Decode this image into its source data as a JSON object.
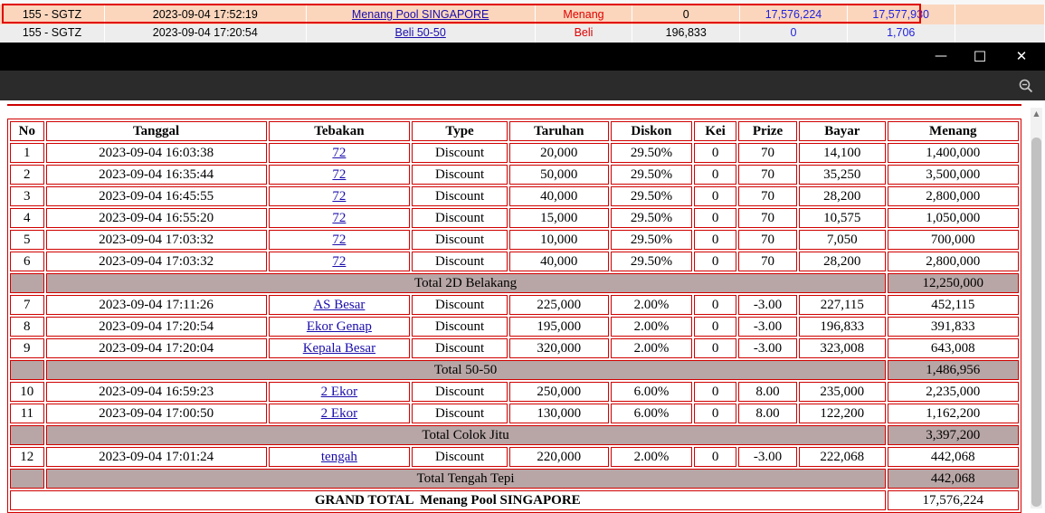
{
  "listing": {
    "row1": {
      "code": "155 - SGTZ",
      "datetime": "2023-09-04 17:52:19",
      "description": "Menang Pool SINGAPORE",
      "type": "Menang",
      "debit": "0",
      "credit": "17,576,224",
      "balance": "17,577,930"
    },
    "row2": {
      "code": "155 - SGTZ",
      "datetime": "2023-09-04 17:20:54",
      "description": "Beli 50-50",
      "type": "Beli",
      "debit": "196,833",
      "credit": "0",
      "balance": "1,706"
    }
  },
  "window": {
    "minimize": "—",
    "maximize": "☐",
    "close": "✕"
  },
  "table": {
    "headers": [
      "No",
      "Tanggal",
      "Tebakan",
      "Type",
      "Taruhan",
      "Diskon",
      "Kei",
      "Prize",
      "Bayar",
      "Menang"
    ],
    "groups": [
      {
        "rows": [
          [
            "1",
            "2023-09-04 16:03:38",
            "72",
            "Discount",
            "20,000",
            "29.50%",
            "0",
            "70",
            "14,100",
            "1,400,000"
          ],
          [
            "2",
            "2023-09-04 16:35:44",
            "72",
            "Discount",
            "50,000",
            "29.50%",
            "0",
            "70",
            "35,250",
            "3,500,000"
          ],
          [
            "3",
            "2023-09-04 16:45:55",
            "72",
            "Discount",
            "40,000",
            "29.50%",
            "0",
            "70",
            "28,200",
            "2,800,000"
          ],
          [
            "4",
            "2023-09-04 16:55:20",
            "72",
            "Discount",
            "15,000",
            "29.50%",
            "0",
            "70",
            "10,575",
            "1,050,000"
          ],
          [
            "5",
            "2023-09-04 17:03:32",
            "72",
            "Discount",
            "10,000",
            "29.50%",
            "0",
            "70",
            "7,050",
            "700,000"
          ],
          [
            "6",
            "2023-09-04 17:03:32",
            "72",
            "Discount",
            "40,000",
            "29.50%",
            "0",
            "70",
            "28,200",
            "2,800,000"
          ]
        ],
        "total_label": "Total 2D Belakang",
        "total_value": "12,250,000"
      },
      {
        "rows": [
          [
            "7",
            "2023-09-04 17:11:26",
            "AS Besar",
            "Discount",
            "225,000",
            "2.00%",
            "0",
            "-3.00",
            "227,115",
            "452,115"
          ],
          [
            "8",
            "2023-09-04 17:20:54",
            "Ekor Genap",
            "Discount",
            "195,000",
            "2.00%",
            "0",
            "-3.00",
            "196,833",
            "391,833"
          ],
          [
            "9",
            "2023-09-04 17:20:04",
            "Kepala Besar",
            "Discount",
            "320,000",
            "2.00%",
            "0",
            "-3.00",
            "323,008",
            "643,008"
          ]
        ],
        "total_label": "Total 50-50",
        "total_value": "1,486,956"
      },
      {
        "rows": [
          [
            "10",
            "2023-09-04 16:59:23",
            "2 Ekor",
            "Discount",
            "250,000",
            "6.00%",
            "0",
            "8.00",
            "235,000",
            "2,235,000"
          ],
          [
            "11",
            "2023-09-04 17:00:50",
            "2 Ekor",
            "Discount",
            "130,000",
            "6.00%",
            "0",
            "8.00",
            "122,200",
            "1,162,200"
          ]
        ],
        "total_label": "Total Colok Jitu",
        "total_value": "3,397,200"
      },
      {
        "rows": [
          [
            "12",
            "2023-09-04 17:01:24",
            "tengah",
            "Discount",
            "220,000",
            "2.00%",
            "0",
            "-3.00",
            "222,068",
            "442,068"
          ]
        ],
        "total_label": "Total Tengah Tepi",
        "total_value": "442,068"
      }
    ],
    "grand_total_label": "GRAND TOTAL  Menang Pool SINGAPORE",
    "grand_total_value": "17,576,224"
  }
}
